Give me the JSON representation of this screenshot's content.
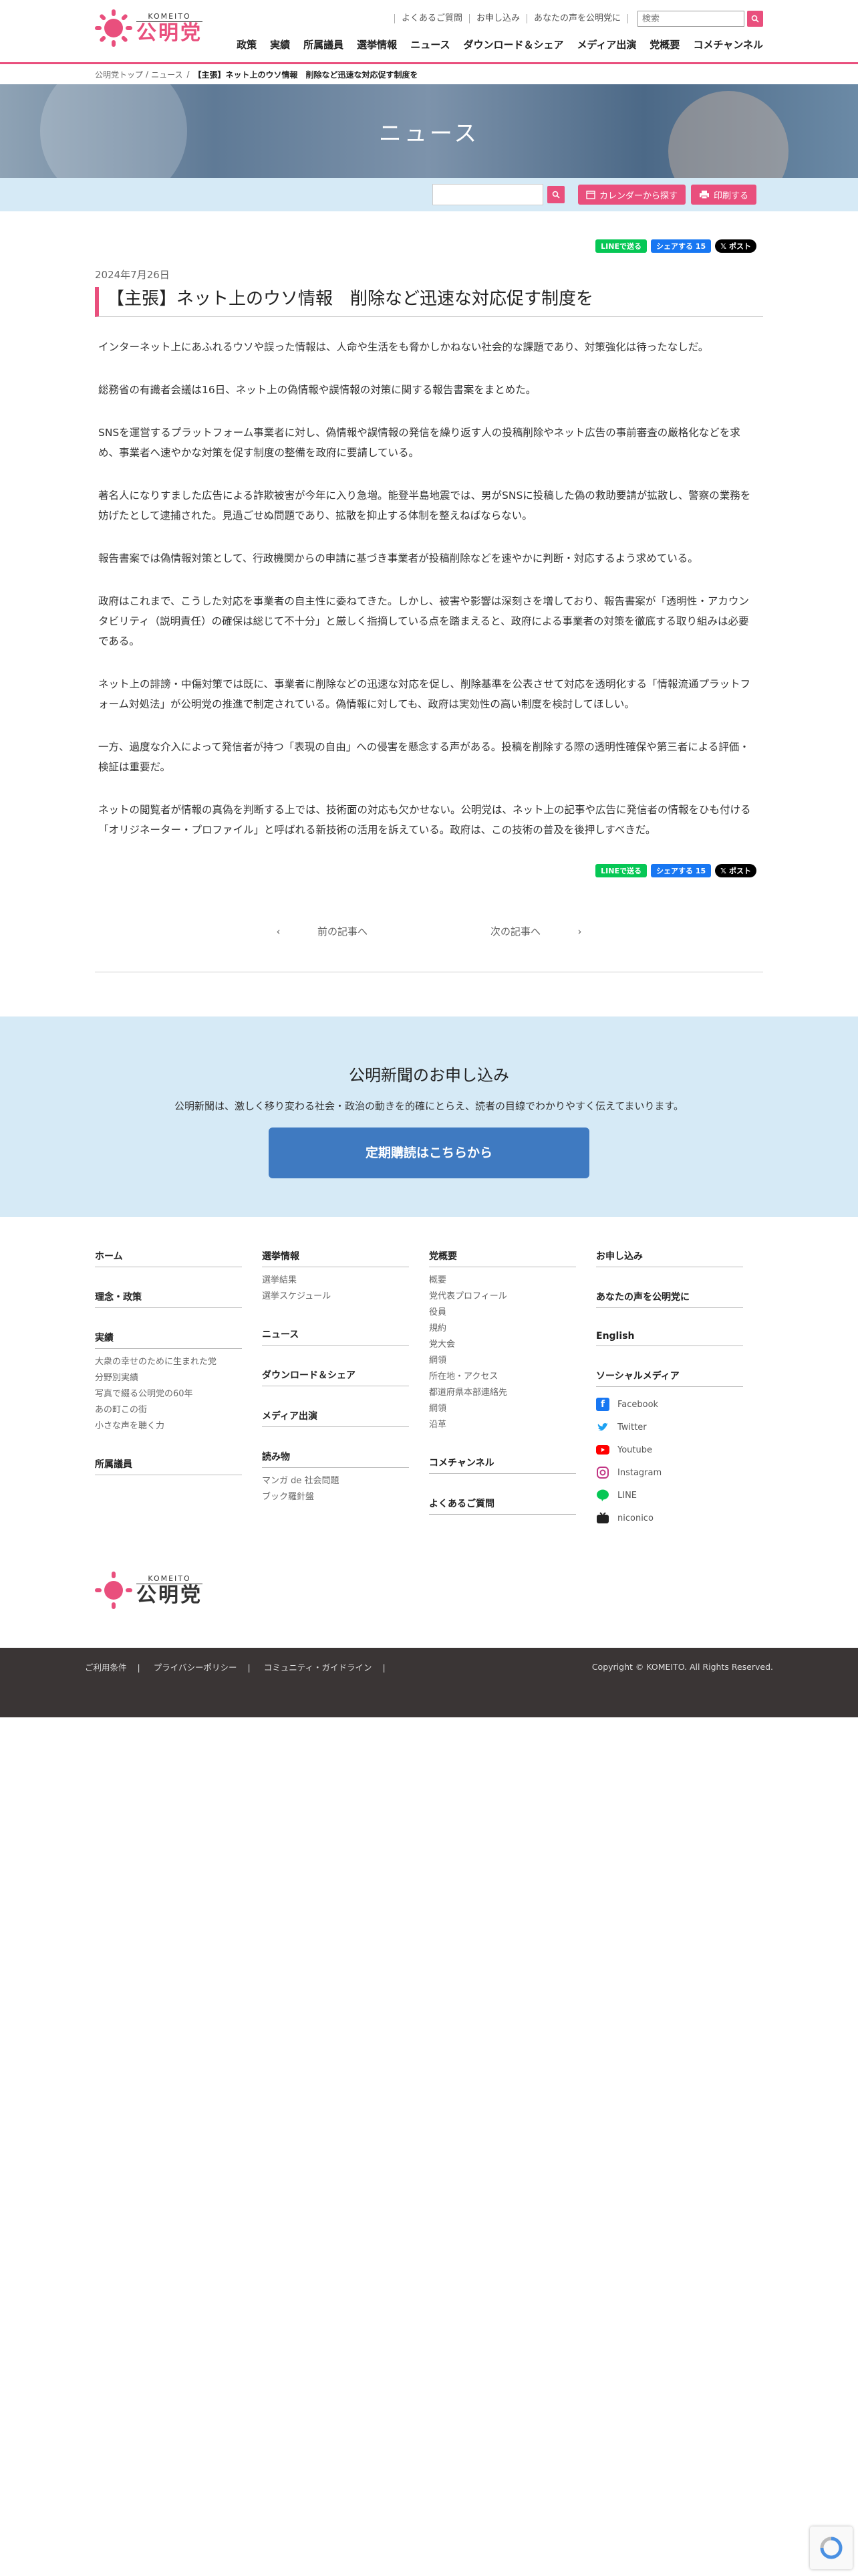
{
  "brand": {
    "sub": "KOMEITO",
    "main": "公明党",
    "color": "#e94f7d"
  },
  "util_links": [
    "よくあるご質問",
    "お申し込み",
    "あなたの声を公明党に"
  ],
  "search": {
    "placeholder": "検索"
  },
  "gnav": [
    "政策",
    "実績",
    "所属議員",
    "選挙情報",
    "ニュース",
    "ダウンロード＆シェア",
    "メディア出演",
    "党概要",
    "コメチャンネル"
  ],
  "breadcrumb": {
    "home": "公明党トップ",
    "sep": "/",
    "section": "ニュース",
    "current": "【主張】ネット上のウソ情報　削除など迅速な対応促す制度を"
  },
  "hero": {
    "title": "ニュース"
  },
  "toolbar": {
    "calendar": "カレンダーから探す",
    "print": "印刷する"
  },
  "share": {
    "line": "LINEで送る",
    "facebook": "シェアする 15",
    "x": "ポスト"
  },
  "article": {
    "date": "2024年7月26日",
    "title": "【主張】ネット上のウソ情報　削除など迅速な対応促す制度を",
    "paragraphs": [
      "インターネット上にあふれるウソや誤った情報は、人命や生活をも脅かしかねない社会的な課題であり、対策強化は待ったなしだ。",
      "総務省の有識者会議は16日、ネット上の偽情報や誤情報の対策に関する報告書案をまとめた。",
      "SNSを運営するプラットフォーム事業者に対し、偽情報や誤情報の発信を繰り返す人の投稿削除やネット広告の事前審査の厳格化などを求め、事業者へ速やかな対策を促す制度の整備を政府に要請している。",
      "著名人になりすました広告による詐欺被害が今年に入り急増。能登半島地震では、男がSNSに投稿した偽の救助要請が拡散し、警察の業務を妨げたとして逮捕された。見過ごせぬ問題であり、拡散を抑止する体制を整えねばならない。",
      "報告書案では偽情報対策として、行政機関からの申請に基づき事業者が投稿削除などを速やかに判断・対応するよう求めている。",
      "政府はこれまで、こうした対応を事業者の自主性に委ねてきた。しかし、被害や影響は深刻さを増しており、報告書案が「透明性・アカウンタビリティ（説明責任）の確保は総じて不十分」と厳しく指摘している点を踏まえると、政府による事業者の対策を徹底する取り組みは必要である。",
      "ネット上の誹謗・中傷対策では既に、事業者に削除などの迅速な対応を促し、削除基準を公表させて対応を透明化する「情報流通プラットフォーム対処法」が公明党の推進で制定されている。偽情報に対しても、政府は実効性の高い制度を検討してほしい。",
      "一方、過度な介入によって発信者が持つ「表現の自由」への侵害を懸念する声がある。投稿を削除する際の透明性確保や第三者による評価・検証は重要だ。",
      "ネットの閲覧者が情報の真偽を判断する上では、技術面の対応も欠かせない。公明党は、ネット上の記事や広告に発信者の情報をひも付ける「オリジネーター・プロファイル」と呼ばれる新技術の活用を訴えている。政府は、この技術の普及を後押しすべきだ。"
    ]
  },
  "pager": {
    "prev": "前の記事へ",
    "next": "次の記事へ"
  },
  "subscription": {
    "title": "公明新聞のお申し込み",
    "desc": "公明新聞は、激しく移り変わる社会・政治の動きを的確にとらえ、読者の目線でわかりやすく伝えてまいります。",
    "cta": "定期購読はこちらから"
  },
  "footer": {
    "col1": {
      "home": "ホーム",
      "policy": "理念・政策",
      "results": "実績",
      "results_items": [
        "大衆の幸せのために生まれた党",
        "分野別実績",
        "写真で綴る公明党の60年",
        "あの町この街",
        "小さな声を聴く力"
      ],
      "members": "所属議員"
    },
    "col2": {
      "election": "選挙情報",
      "election_items": [
        "選挙結果",
        "選挙スケジュール"
      ],
      "news": "ニュース",
      "download": "ダウンロード＆シェア",
      "media": "メディア出演",
      "reading": "読み物",
      "reading_items": [
        "マンガ de 社会問題",
        "ブック羅針盤"
      ]
    },
    "col3": {
      "about": "党概要",
      "about_items": [
        "概要",
        "党代表プロフィール",
        "役員",
        "規約",
        "党大会",
        "綱領",
        "所在地・アクセス",
        "都道府県本部連絡先",
        "綱領",
        "沿革"
      ],
      "komech": "コメチャンネル",
      "faq": "よくあるご質問"
    },
    "col4": {
      "apply": "お申し込み",
      "voice": "あなたの声を公明党に",
      "english": "English",
      "social": "ソーシャルメディア",
      "social_items": [
        "Facebook",
        "Twitter",
        "Youtube",
        "Instagram",
        "LINE",
        "niconico"
      ]
    },
    "legal": [
      "ご利用条件",
      "プライバシーポリシー",
      "コミュニティ・ガイドライン"
    ],
    "copyright": "Copyright © KOMEITO. All Rights Reserved."
  }
}
